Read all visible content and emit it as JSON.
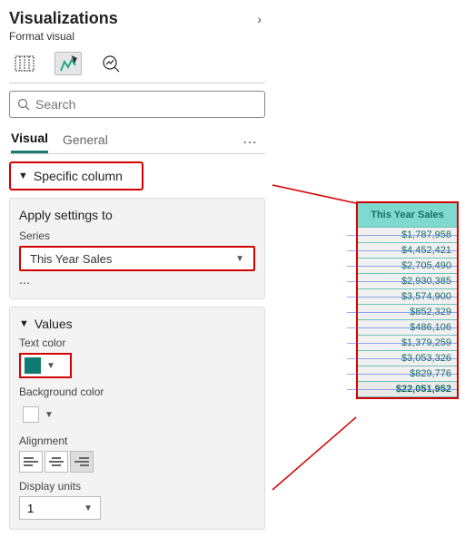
{
  "header": {
    "title": "Visualizations",
    "subtitle": "Format visual"
  },
  "search": {
    "placeholder": "Search"
  },
  "tabs": {
    "visual": "Visual",
    "general": "General"
  },
  "sections": {
    "specific_column": "Specific column",
    "apply_settings_to": "Apply settings to",
    "series_label": "Series",
    "series_value": "This Year Sales",
    "values": "Values",
    "text_color": "Text color",
    "background_color": "Background color",
    "alignment": "Alignment",
    "display_units": "Display units",
    "display_units_value": "1"
  },
  "colors": {
    "text": "#0f7a6f",
    "background": "#ffffff"
  },
  "alignment_selected": "right",
  "table": {
    "header": "This Year Sales",
    "rows": [
      "$1,787,958",
      "$4,452,421",
      "$2,705,490",
      "$2,930,385",
      "$3,574,900",
      "$852,329",
      "$486,106",
      "$1,379,259",
      "$3,053,326",
      "$829,776"
    ],
    "total": "$22,051,952"
  }
}
